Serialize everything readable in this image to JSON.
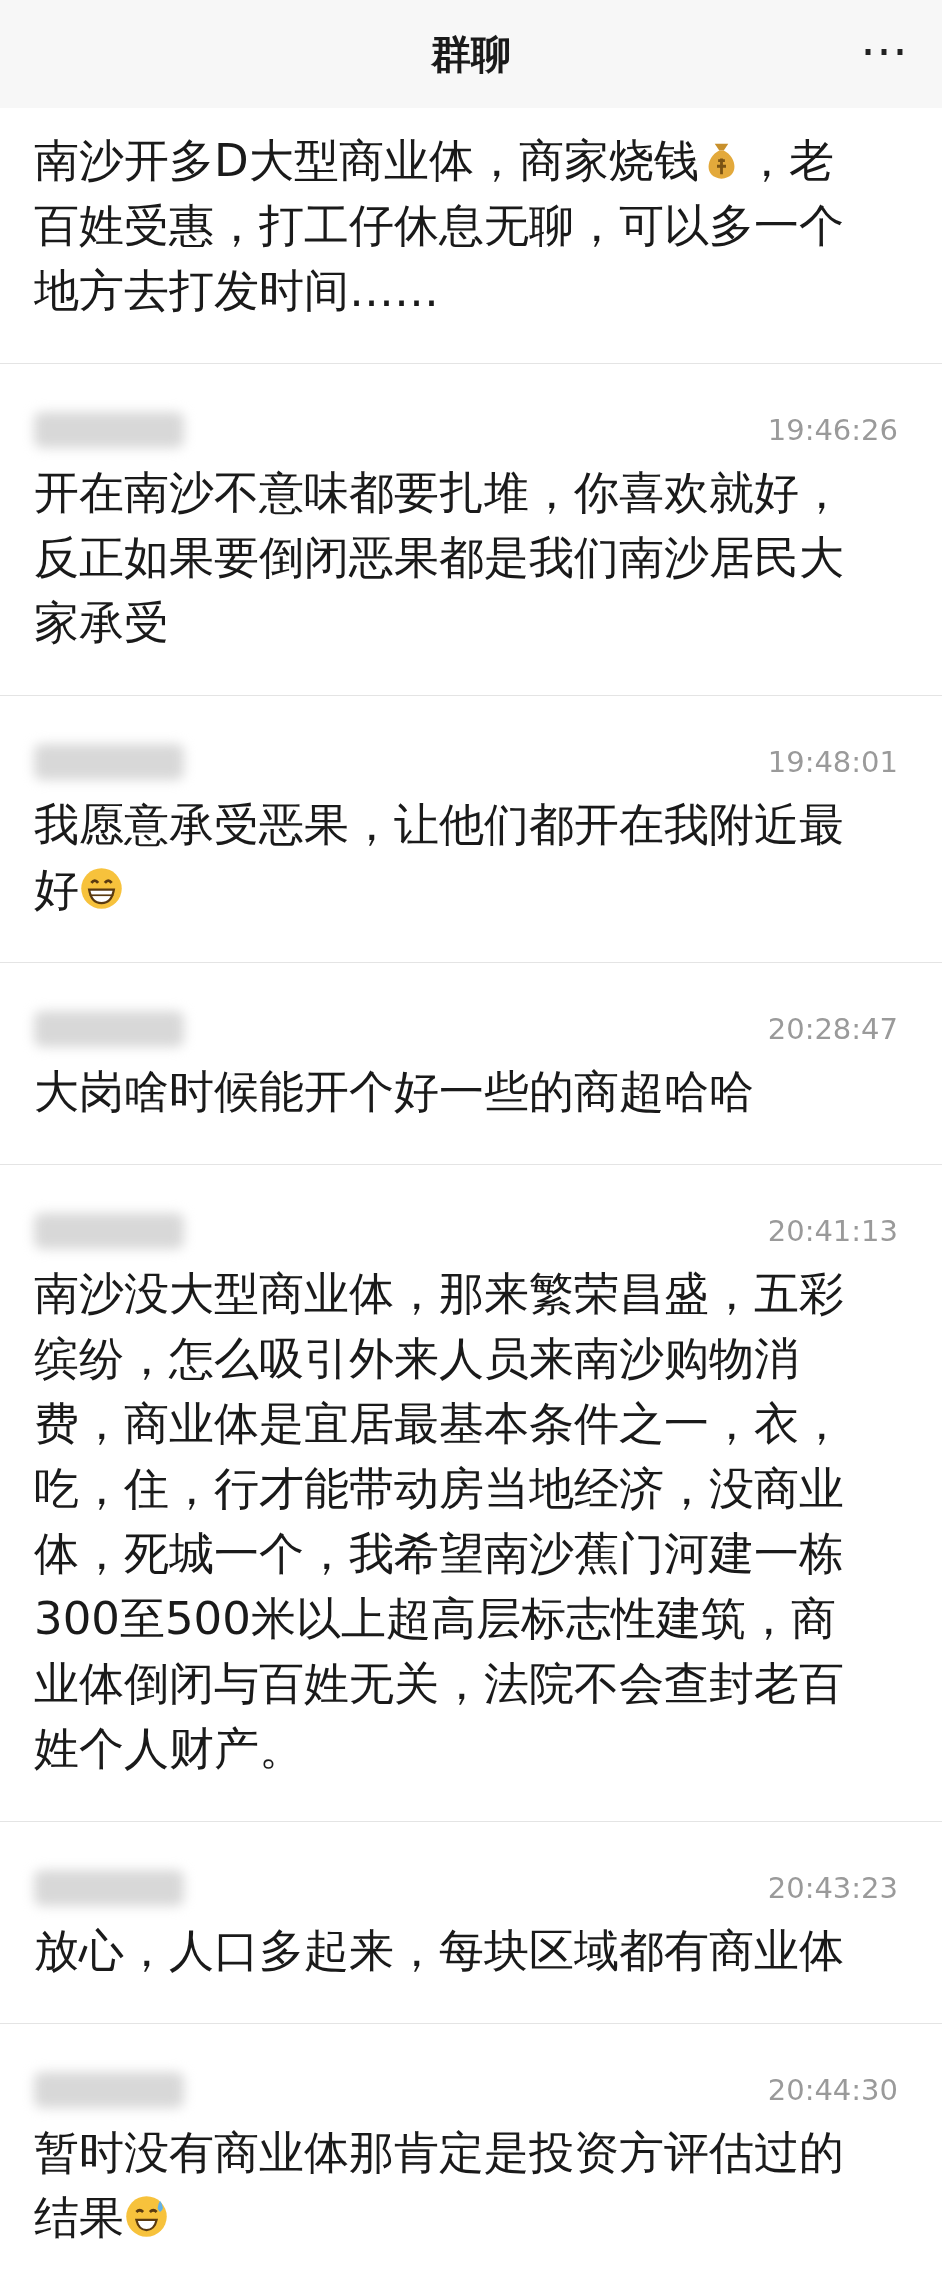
{
  "header": {
    "title": "群聊",
    "more": "⋯"
  },
  "messages": [
    {
      "sender_redacted": false,
      "segments": [
        {
          "kind": "text",
          "text": "南沙开多D大型商业体，商家烧钱"
        },
        {
          "kind": "money-bag"
        },
        {
          "kind": "text",
          "text": "，老百姓受惠，打工仔休息无聊，可以多一个地方去打发时间……"
        }
      ]
    },
    {
      "sender_redacted": true,
      "time": "19:46:26",
      "segments": [
        {
          "kind": "text",
          "text": "开在南沙不意味都要扎堆，你喜欢就好，反正如果要倒闭恶果都是我们南沙居民大家承受"
        }
      ]
    },
    {
      "sender_redacted": true,
      "time": "19:48:01",
      "segments": [
        {
          "kind": "text",
          "text": "我愿意承受恶果，让他们都开在我附近最好"
        },
        {
          "kind": "grin"
        }
      ]
    },
    {
      "sender_redacted": true,
      "time": "20:28:47",
      "segments": [
        {
          "kind": "text",
          "text": "大岗啥时候能开个好一些的商超哈哈"
        }
      ]
    },
    {
      "sender_redacted": true,
      "time": "20:41:13",
      "segments": [
        {
          "kind": "text",
          "text": "南沙没大型商业体，那来繁荣昌盛，五彩缤纷，怎么吸引外来人员来南沙购物消费，商业体是宜居最基本条件之一，衣，吃，住，行才能带动房当地经济，没商业体，死城一个，我希望南沙蕉门河建一栋300至500米以上超高层标志性建筑，商业体倒闭与百姓无关，法院不会查封老百姓个人财产。"
        }
      ]
    },
    {
      "sender_redacted": true,
      "time": "20:43:23",
      "segments": [
        {
          "kind": "text",
          "text": "放心，人口多起来，每块区域都有商业体"
        }
      ]
    },
    {
      "sender_redacted": true,
      "time": "20:44:30",
      "segments": [
        {
          "kind": "text",
          "text": "暂时没有商业体那肯定是投资方评估过的结果"
        },
        {
          "kind": "sweat-smile"
        }
      ]
    }
  ]
}
